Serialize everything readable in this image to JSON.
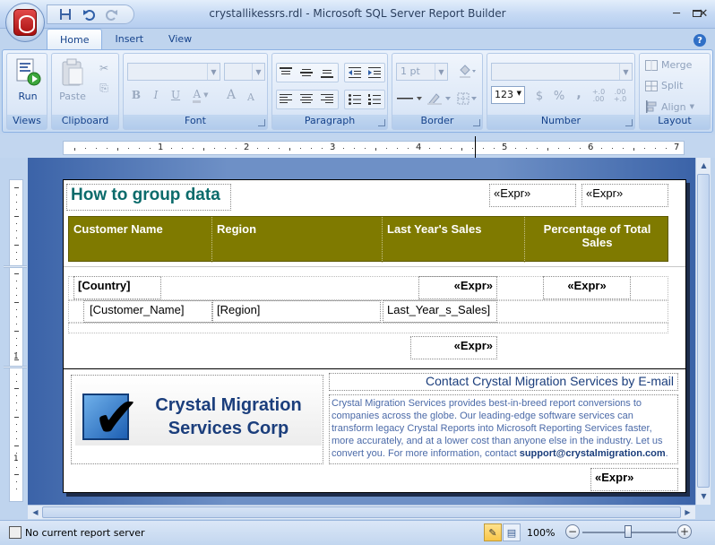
{
  "window": {
    "title": "crystallikessrs.rdl - Microsoft SQL Server Report Builder",
    "minimize": "─",
    "maximize": "▭",
    "close": "✕"
  },
  "qat": {
    "save": "💾",
    "undo": "↶",
    "redo": "↷"
  },
  "tabs": [
    {
      "label": "Home"
    },
    {
      "label": "Insert"
    },
    {
      "label": "View"
    }
  ],
  "help": "?",
  "ribbon": {
    "views": {
      "run_label": "Run",
      "group_label": "Views"
    },
    "clipboard": {
      "paste_label": "Paste",
      "group_label": "Clipboard",
      "cut": "✂",
      "copy": "⎘"
    },
    "font": {
      "group_label": "Font",
      "bold": "B",
      "italic": "I",
      "underline": "U",
      "color": "A",
      "grow": "A",
      "shrink": "A"
    },
    "paragraph": {
      "group_label": "Paragraph"
    },
    "border": {
      "group_label": "Border",
      "width_value": "1 pt"
    },
    "number": {
      "group_label": "Number",
      "format": "123",
      "currency": "$",
      "percent": "%",
      "comma": ",",
      "inc_decimal": "+.0\n.00",
      "dec_decimal": ".00\n+.0"
    },
    "layout": {
      "group_label": "Layout",
      "merge": "Merge",
      "split": "Split",
      "align": "Align"
    }
  },
  "ruler": {
    "numbers": [
      "1",
      "2",
      "3",
      "4",
      "5",
      "6",
      "7"
    ]
  },
  "vruler": {
    "numbers": [
      "1",
      "1"
    ]
  },
  "report": {
    "title": "How to group data",
    "header_expr_1": "«Expr»",
    "header_expr_2": "«Expr»",
    "columns": [
      "Customer Name",
      "Region",
      "Last Year's Sales",
      "Percentage of Total Sales"
    ],
    "group_country": "[Country]",
    "group_expr_1": "«Expr»",
    "group_expr_2": "«Expr»",
    "detail_customer": "[Customer_Name]",
    "detail_region": "[Region]",
    "detail_sales": "Last_Year_s_Sales]",
    "total_expr": "«Expr»",
    "footer": {
      "logo_line1": "Crystal Migration",
      "logo_line2": "Services Corp",
      "contact_title": "Contact Crystal Migration Services by E-mail",
      "contact_body": "Crystal Migration Services provides best-in-breed report conversions to companies across the globe. Our leading-edge software services can transform legacy Crystal Reports into Microsoft Reporting Services faster, more accurately, and at a lower cost than anyone else in the industry. Let us convert you. For more information, contact ",
      "contact_email": "support@crystalmigration.com",
      "contact_end": ".",
      "page_expr": "«Expr»"
    }
  },
  "status": {
    "text": "No current report server",
    "zoom": "100%",
    "zoom_out": "−",
    "zoom_in": "+"
  }
}
